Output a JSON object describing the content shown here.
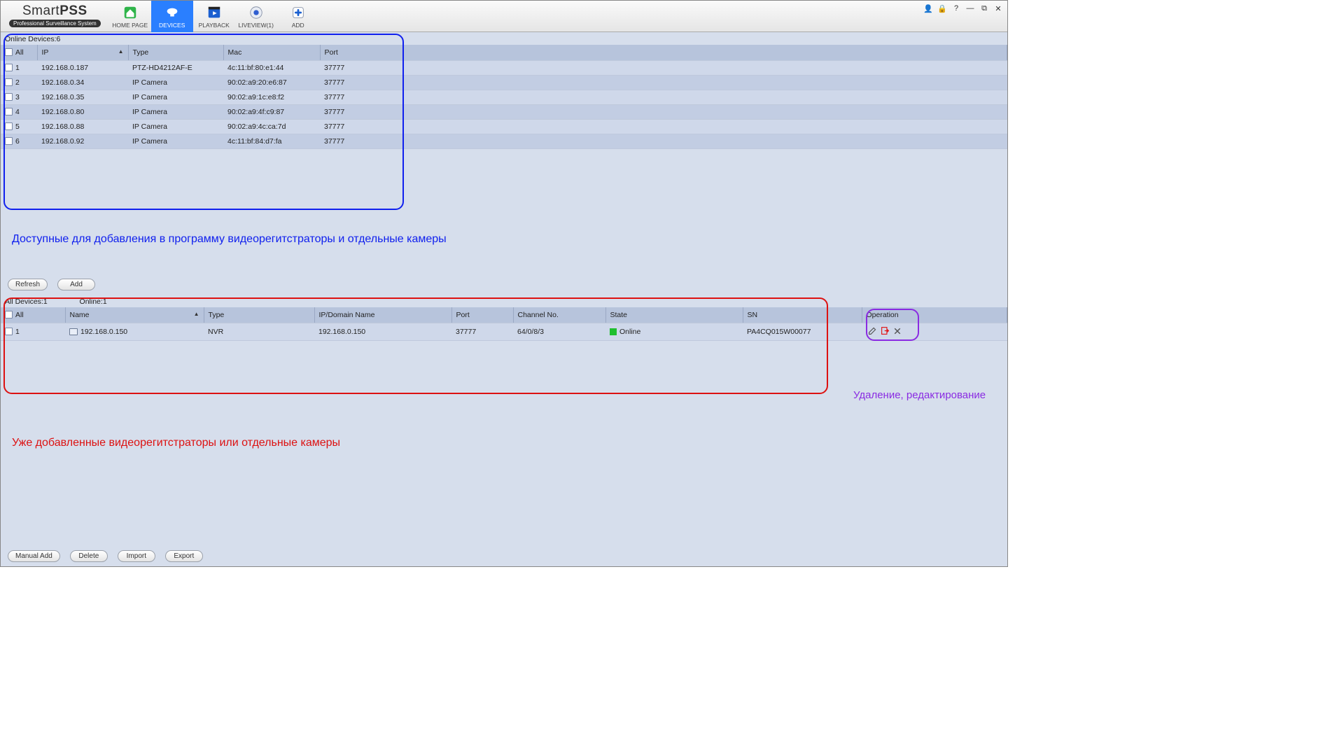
{
  "brand": {
    "title_light": "Smart",
    "title_bold": "PSS",
    "subtitle": "Professional Surveillance System"
  },
  "nav": [
    {
      "label": "HOME PAGE"
    },
    {
      "label": "DEVICES"
    },
    {
      "label": "PLAYBACK"
    },
    {
      "label": "LIVEVIEW(1)"
    },
    {
      "label": "ADD"
    }
  ],
  "online": {
    "label": "Online Devices:6",
    "cols": {
      "all": "All",
      "ip": "IP",
      "type": "Type",
      "mac": "Mac",
      "port": "Port"
    },
    "rows": [
      {
        "idx": "1",
        "ip": "192.168.0.187",
        "type": "PTZ-HD4212AF-E",
        "mac": "4c:11:bf:80:e1:44",
        "port": "37777"
      },
      {
        "idx": "2",
        "ip": "192.168.0.34",
        "type": "IP Camera",
        "mac": "90:02:a9:20:e6:87",
        "port": "37777"
      },
      {
        "idx": "3",
        "ip": "192.168.0.35",
        "type": "IP Camera",
        "mac": "90:02:a9:1c:e8:f2",
        "port": "37777"
      },
      {
        "idx": "4",
        "ip": "192.168.0.80",
        "type": "IP Camera",
        "mac": "90:02:a9:4f:c9:87",
        "port": "37777"
      },
      {
        "idx": "5",
        "ip": "192.168.0.88",
        "type": "IP Camera",
        "mac": "90:02:a9:4c:ca:7d",
        "port": "37777"
      },
      {
        "idx": "6",
        "ip": "192.168.0.92",
        "type": "IP Camera",
        "mac": "4c:11:bf:84:d7:fa",
        "port": "37777"
      }
    ]
  },
  "all": {
    "label_all": "All Devices:1",
    "label_online": "Online:1",
    "cols": {
      "all": "All",
      "name": "Name",
      "type": "Type",
      "ipdn": "IP/Domain Name",
      "port": "Port",
      "channel": "Channel No.",
      "state": "State",
      "sn": "SN",
      "operation": "Operation"
    },
    "rows": [
      {
        "idx": "1",
        "name": "192.168.0.150",
        "type": "NVR",
        "ipdn": "192.168.0.150",
        "port": "37777",
        "channel": "64/0/8/3",
        "state": "Online",
        "sn": "PA4CQ015W00077"
      }
    ]
  },
  "buttons": {
    "refresh": "Refresh",
    "add": "Add",
    "manual_add": "Manual Add",
    "delete": "Delete",
    "import": "Import",
    "export": "Export"
  },
  "annotations": {
    "blue": "Доступные для добавления в программу видеорегитстраторы и отдельные камеры",
    "red": "Уже добавленные видеорегитстраторы или отдельные камеры",
    "purple": "Удаление, редактирование"
  }
}
